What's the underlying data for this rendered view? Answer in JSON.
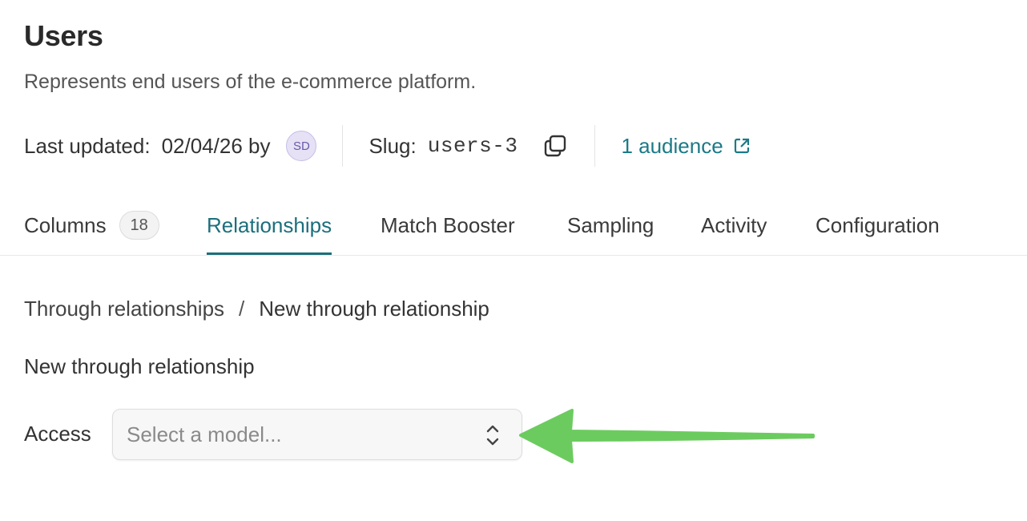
{
  "header": {
    "title": "Users",
    "description": "Represents end users of the e-commerce platform."
  },
  "meta": {
    "last_updated_label": "Last updated:",
    "last_updated_date": "02/04/26 by",
    "avatar_initials": "SD",
    "slug_label": "Slug:",
    "slug_value": "users-3",
    "audience_link": "1 audience"
  },
  "tabs": [
    {
      "label": "Columns",
      "badge": "18"
    },
    {
      "label": "Relationships",
      "active": true
    },
    {
      "label": "Match Booster"
    },
    {
      "label": "Sampling"
    },
    {
      "label": "Activity"
    },
    {
      "label": "Configuration"
    }
  ],
  "breadcrumb": {
    "parent": "Through relationships",
    "separator": "/",
    "current": "New through relationship"
  },
  "form": {
    "section_title": "New through relationship",
    "access_label": "Access",
    "model_select_placeholder": "Select a model..."
  },
  "colors": {
    "accent": "#1b6f7c",
    "link": "#1b7a87",
    "annotation_arrow": "#6ccb5f"
  }
}
